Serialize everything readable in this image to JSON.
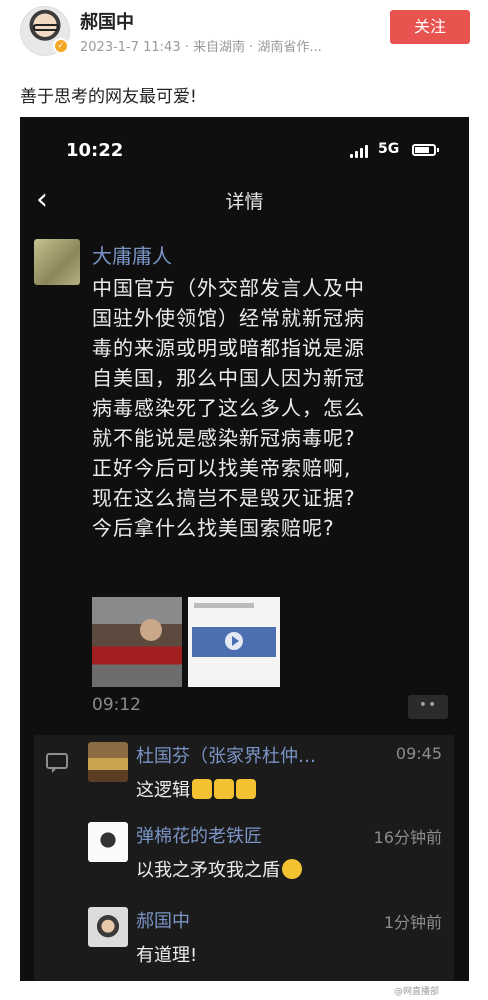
{
  "post": {
    "author": "郝国中",
    "meta": "2023-1-7 11:43 · 来自湖南 · 湖南省作...",
    "follow_label": "关注",
    "text": "善于思考的网友最可爱!"
  },
  "screenshot": {
    "status": {
      "time": "10:22",
      "network": "5G"
    },
    "nav": {
      "title": "详情"
    },
    "moment": {
      "poster": "大庸庸人",
      "lines": [
        "中国官方（外交部发言人及中",
        "国驻外使领馆）经常就新冠病",
        "毒的来源或明或暗都指说是源",
        "自美国，那么中国人因为新冠",
        "病毒感染死了这么多人，怎么",
        "就不能说是感染新冠病毒呢?",
        "正好今后可以找美帝索赔啊,",
        "现在这么搞岂不是毁灭证据?",
        "今后拿什么找美国索赔呢?"
      ],
      "time": "09:12",
      "more": "••"
    },
    "comments": [
      {
        "name": "杜国芬（张家界杜仲…",
        "time": "09:45",
        "text": "这逻辑"
      },
      {
        "name": "弹棉花的老铁匠",
        "time": "16分钟前",
        "text": "以我之矛攻我之盾"
      },
      {
        "name": "郝国中",
        "time": "1分钟前",
        "text": "有道理!"
      }
    ]
  },
  "watermark": "@网直播部"
}
